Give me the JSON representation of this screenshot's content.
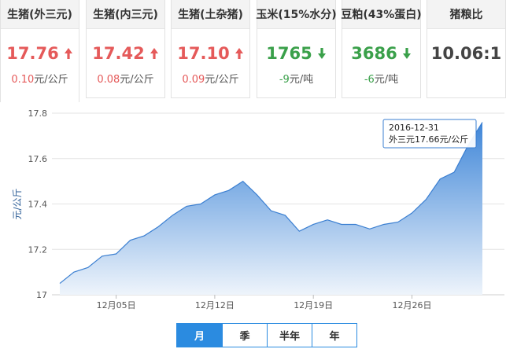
{
  "cards": [
    {
      "title": "生猪(外三元)",
      "price": "17.76",
      "dir": "up",
      "change": "0.10",
      "unit": "元/公斤",
      "active": true
    },
    {
      "title": "生猪(内三元)",
      "price": "17.42",
      "dir": "up",
      "change": "0.08",
      "unit": "元/公斤",
      "active": false
    },
    {
      "title": "生猪(土杂猪)",
      "price": "17.10",
      "dir": "up",
      "change": "0.09",
      "unit": "元/公斤",
      "active": false
    },
    {
      "title": "玉米(15%水分)",
      "price": "1765",
      "dir": "down",
      "change": "-9",
      "unit": "元/吨",
      "active": false
    },
    {
      "title": "豆粕(43%蛋白)",
      "price": "3686",
      "dir": "down",
      "change": "-6",
      "unit": "元/吨",
      "active": false
    }
  ],
  "ratio": {
    "title": "猪粮比",
    "value": "10.06:1"
  },
  "colors": {
    "up": "#e55a5a",
    "down": "#3aa04a",
    "accent": "#2b8be0"
  },
  "tabs": [
    {
      "label": "月",
      "active": true
    },
    {
      "label": "季",
      "active": false
    },
    {
      "label": "半年",
      "active": false
    },
    {
      "label": "年",
      "active": false
    }
  ],
  "tooltip": {
    "date": "2016-12-31",
    "text": "外三元17.66元/公斤"
  },
  "chart_data": {
    "type": "area",
    "ylabel": "元/公斤",
    "ylim": [
      17.0,
      17.8
    ],
    "yticks": [
      "17",
      "17.2",
      "17.4",
      "17.6",
      "17.8"
    ],
    "xticks": [
      {
        "day": 5,
        "label": "12月05日"
      },
      {
        "day": 12,
        "label": "12月12日"
      },
      {
        "day": 19,
        "label": "12月19日"
      },
      {
        "day": 26,
        "label": "12月26日"
      }
    ],
    "series": [
      {
        "days": [
          1,
          2,
          3,
          4,
          5,
          6,
          7,
          8,
          9,
          10,
          11,
          12,
          13,
          14,
          15,
          16,
          17,
          18,
          19,
          20,
          21,
          22,
          23,
          24,
          25,
          26,
          27,
          28,
          29,
          30,
          31
        ],
        "values": [
          17.05,
          17.1,
          17.12,
          17.17,
          17.18,
          17.24,
          17.26,
          17.3,
          17.35,
          17.39,
          17.4,
          17.44,
          17.46,
          17.5,
          17.44,
          17.37,
          17.35,
          17.28,
          17.31,
          17.33,
          17.31,
          17.31,
          17.29,
          17.31,
          17.32,
          17.36,
          17.42,
          17.51,
          17.54,
          17.66,
          17.76
        ]
      }
    ]
  }
}
